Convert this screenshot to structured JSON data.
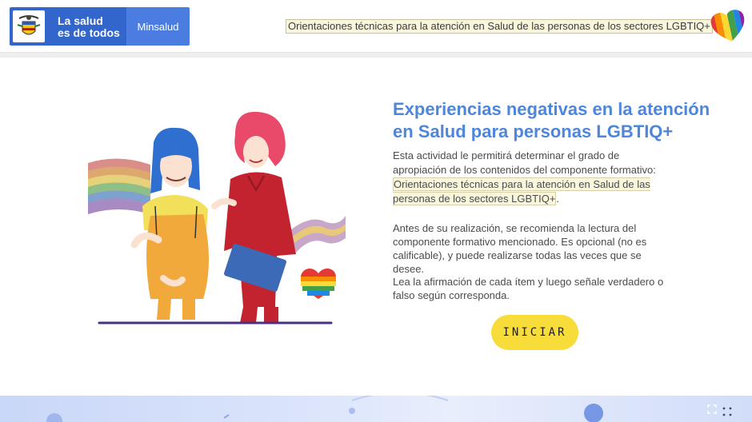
{
  "header": {
    "gov_slogan_line1": "La salud",
    "gov_slogan_line2": "es de todos",
    "ministry": "Minsalud",
    "course_title": "Orientaciones técnicas para la atención en Salud de las personas de los sectores LGBTIQ+"
  },
  "main": {
    "heading": "Experiencias negativas en la atención en Salud para personas LGBTIQ+",
    "intro_text": "Esta actividad le permitirá determinar el grado de apropiación de los contenidos del componente formativo:",
    "intro_highlight": "Orientaciones técnicas para la atención en Salud de las personas de los sectores LGBTIQ+",
    "intro_end": ".",
    "recommendation": "Antes de su realización, se recomienda la lectura del componente formativo mencionado. Es opcional (no es calificable), y puede realizarse todas las veces que se desee.",
    "instructions": "Lea la afirmación de cada ítem y luego señale verdadero o falso según corresponda.",
    "start_label": "INICIAR"
  },
  "icons": {
    "crest": "colombia-crest-icon",
    "heart": "rainbow-heart-icon",
    "expand": "expand-icon",
    "menu": "dots-grid-icon"
  },
  "colors": {
    "brand_blue": "#3366cc",
    "heading_blue": "#4d86db",
    "button_yellow": "#f7dc3a"
  }
}
